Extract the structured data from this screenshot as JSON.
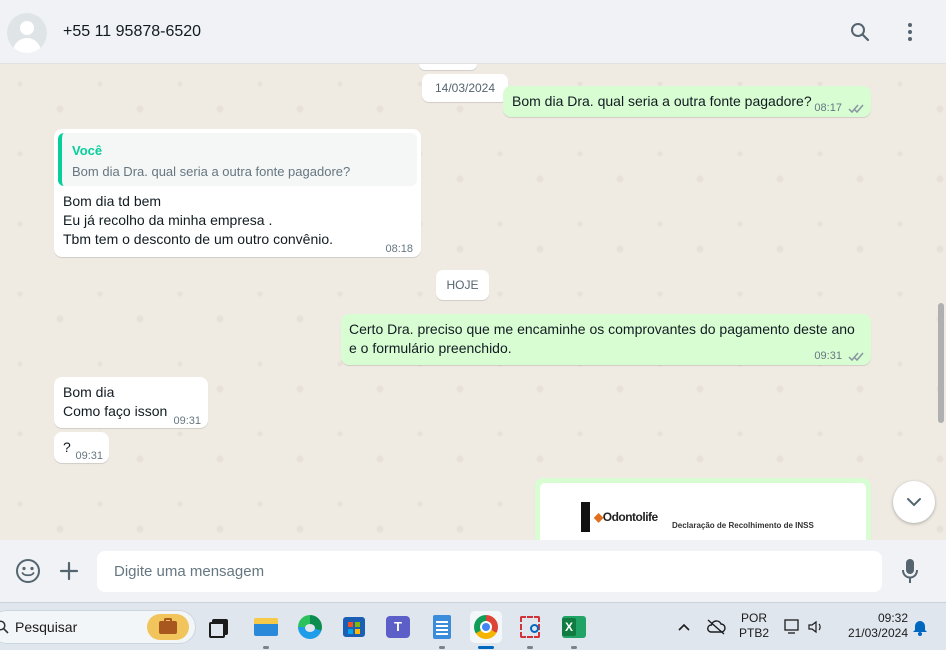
{
  "header": {
    "contact_name": "+55 11 95878-6520",
    "icons": [
      "avatar",
      "search-icon",
      "menu-dots-icon"
    ]
  },
  "chat": {
    "date_chip_1": "14/03/2024",
    "msg1": {
      "text": "Bom dia Dra. qual seria a outra fonte pagadore?",
      "time": "08:17"
    },
    "msg2": {
      "quote_author": "Você",
      "quote_text": "Bom dia Dra. qual seria a outra fonte pagadore?",
      "line1": "Bom dia td bem",
      "line2": "Eu já recolho da minha empresa .",
      "line3": "Tbm tem o desconto de um outro convênio.",
      "time": "08:18"
    },
    "date_chip_2": "HOJE",
    "msg3": {
      "line1": "Certo Dra. preciso que me encaminhe os comprovantes do pagamento deste ano",
      "line2": "e o formulário preenchido.",
      "time": "09:31"
    },
    "msg4": {
      "line1": "Bom dia",
      "line2": "Como faço isson",
      "time": "09:31"
    },
    "msg5": {
      "text": "?",
      "time": "09:31"
    },
    "doc_preview": {
      "logo_text": "Odontolife",
      "title": "Declaração de Recolhimento de INSS"
    }
  },
  "composer": {
    "placeholder": "Digite uma mensagem"
  },
  "taskbar": {
    "search_label": "Pesquisar",
    "lang_line1": "POR",
    "lang_line2": "PTB2",
    "time": "09:32",
    "date": "21/03/2024"
  },
  "colors": {
    "incoming": "#ffffff",
    "outgoing": "#d9fdd3",
    "accent": "#06cf9c",
    "chat_bg": "#efeae2",
    "read_ticks": "#53bdeb"
  }
}
